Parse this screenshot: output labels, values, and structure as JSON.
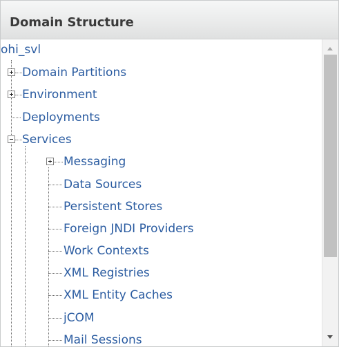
{
  "panel": {
    "title": "Domain Structure"
  },
  "tree": {
    "root": "ohi_svl",
    "nodes": [
      {
        "label": "Domain Partitions",
        "expander": "plus"
      },
      {
        "label": "Environment",
        "expander": "plus"
      },
      {
        "label": "Deployments",
        "expander": "none"
      },
      {
        "label": "Services",
        "expander": "minus"
      },
      {
        "label": "Messaging",
        "expander": "plus"
      },
      {
        "label": "Data Sources",
        "expander": "none"
      },
      {
        "label": "Persistent Stores",
        "expander": "none"
      },
      {
        "label": "Foreign JNDI Providers",
        "expander": "none"
      },
      {
        "label": "Work Contexts",
        "expander": "none"
      },
      {
        "label": "XML Registries",
        "expander": "none"
      },
      {
        "label": "XML Entity Caches",
        "expander": "none"
      },
      {
        "label": "jCOM",
        "expander": "none"
      },
      {
        "label": "Mail Sessions",
        "expander": "none"
      }
    ]
  },
  "colors": {
    "link": "#2b5ca1",
    "title": "#3a3a3a",
    "header_bg": "#e9eaea",
    "scroll_thumb": "#c1c1c1"
  },
  "icons": {
    "expand": "plus-box-icon",
    "collapse": "minus-box-icon",
    "scroll_up": "triangle-up-icon",
    "scroll_down": "triangle-down-icon"
  }
}
